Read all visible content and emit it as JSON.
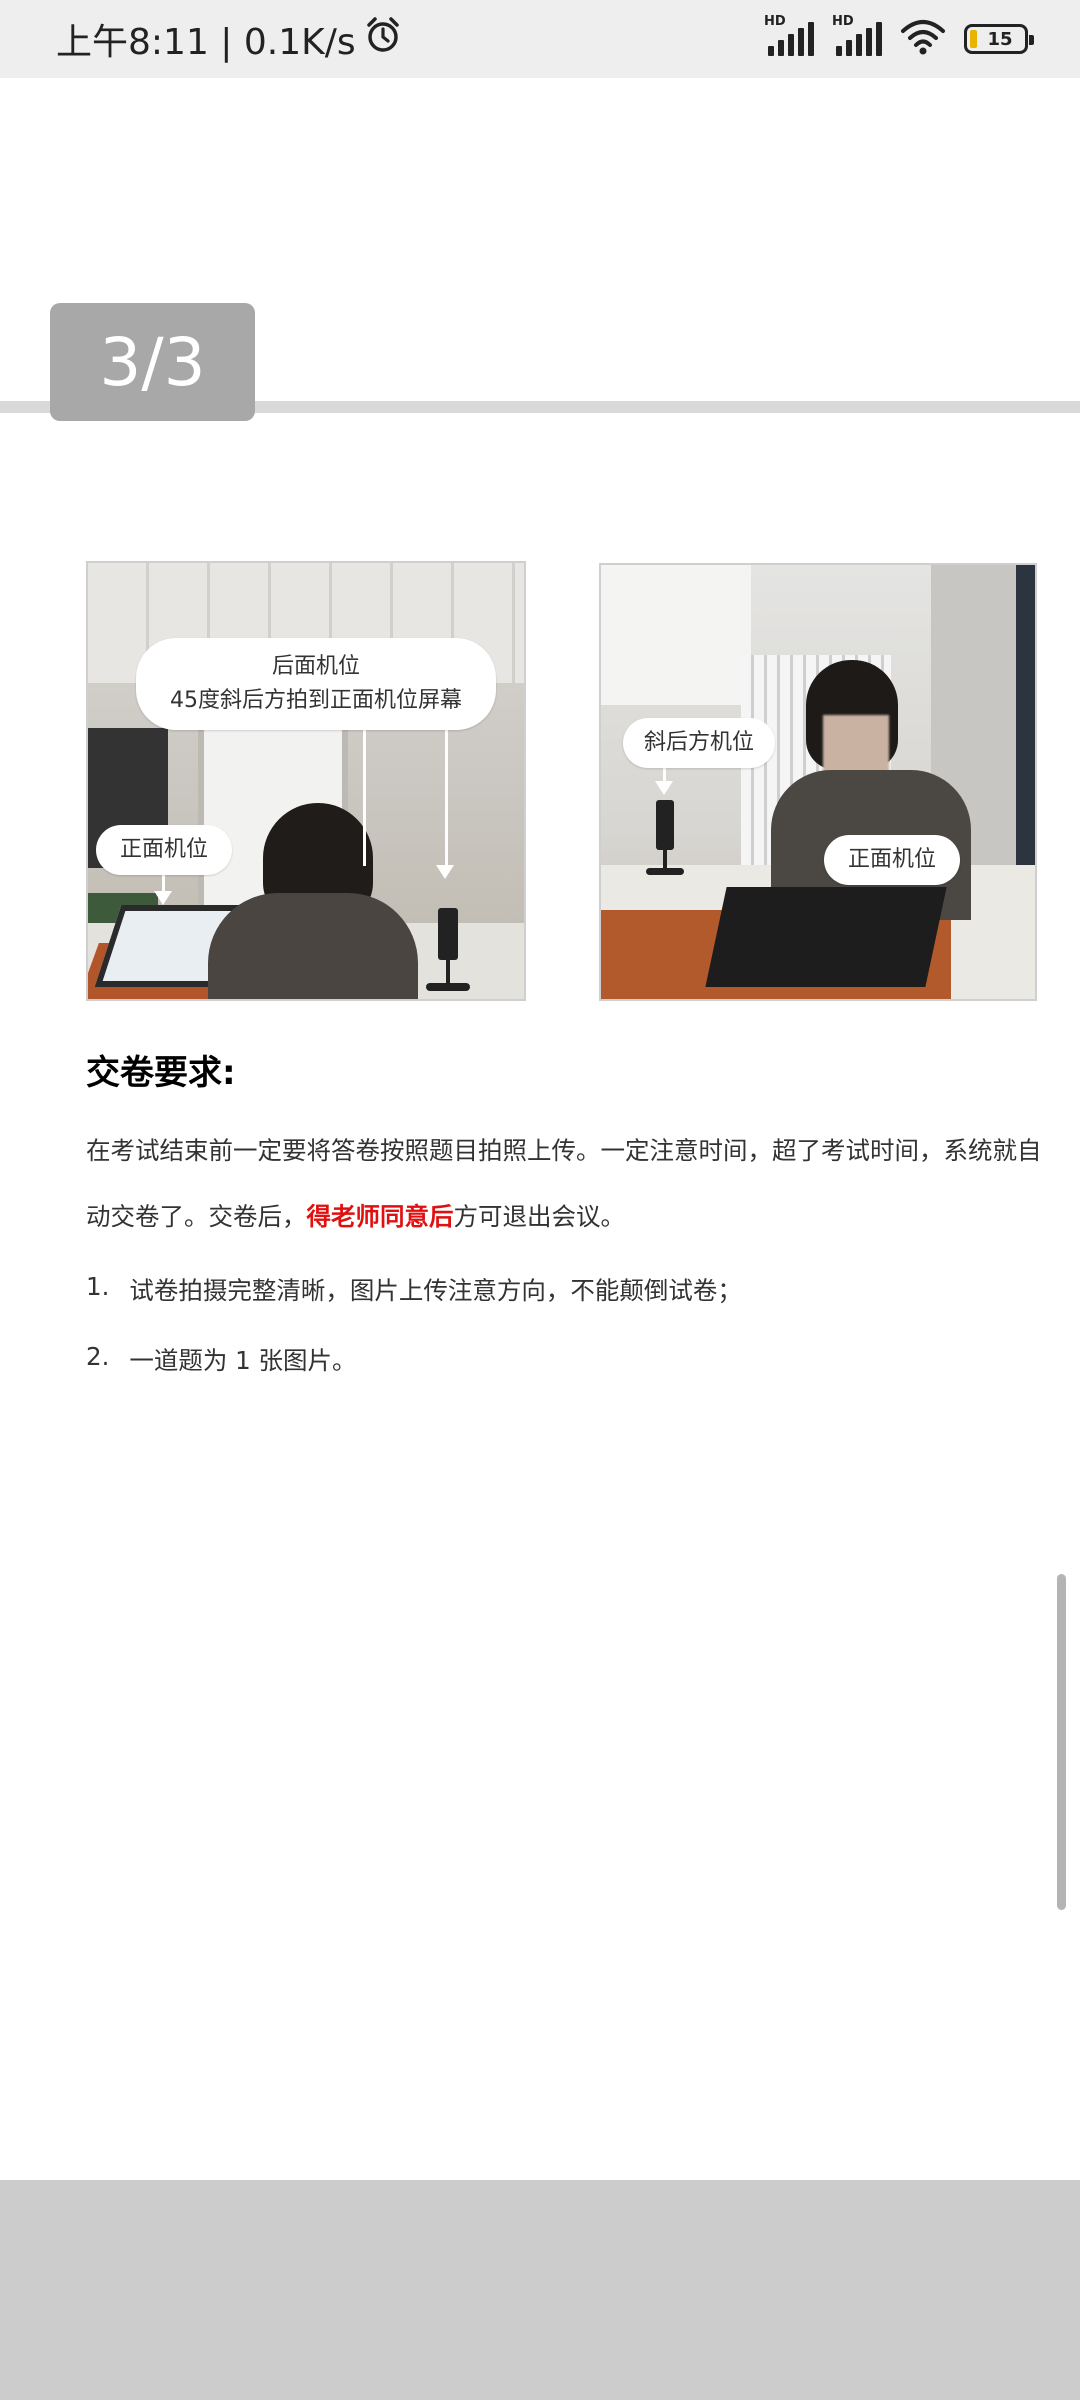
{
  "status_bar": {
    "time_and_speed": "上午8:11 | 0.1K/s",
    "alarm_icon": "alarm-clock-icon",
    "signal_label": "HD",
    "wifi_icon": "wifi-icon",
    "battery_level": "15",
    "battery_color": "#e8b400"
  },
  "viewer": {
    "page_indicator": "3/3"
  },
  "photo_left": {
    "label_back_title": "后面机位",
    "label_back_desc": "45度斜后方拍到正面机位屏幕",
    "label_front": "正面机位"
  },
  "photo_right": {
    "label_oblique": "斜后方机位",
    "label_front": "正面机位"
  },
  "content": {
    "section_title": "交卷要求:",
    "paragraph_part1": "在考试结束前一定要将答卷按照题目拍照上传。一定注意时间，超了考试时间，系统就自动交卷了。交卷后，",
    "paragraph_emphasis": "得老师同意后",
    "paragraph_part2": "方可退出会议。",
    "emphasis_color": "#e01010",
    "list": [
      {
        "num": "1.",
        "text": "试卷拍摄完整清晰，图片上传注意方向，不能颠倒试卷；"
      },
      {
        "num": "2.",
        "text": "一道题为 1 张图片。"
      }
    ]
  }
}
